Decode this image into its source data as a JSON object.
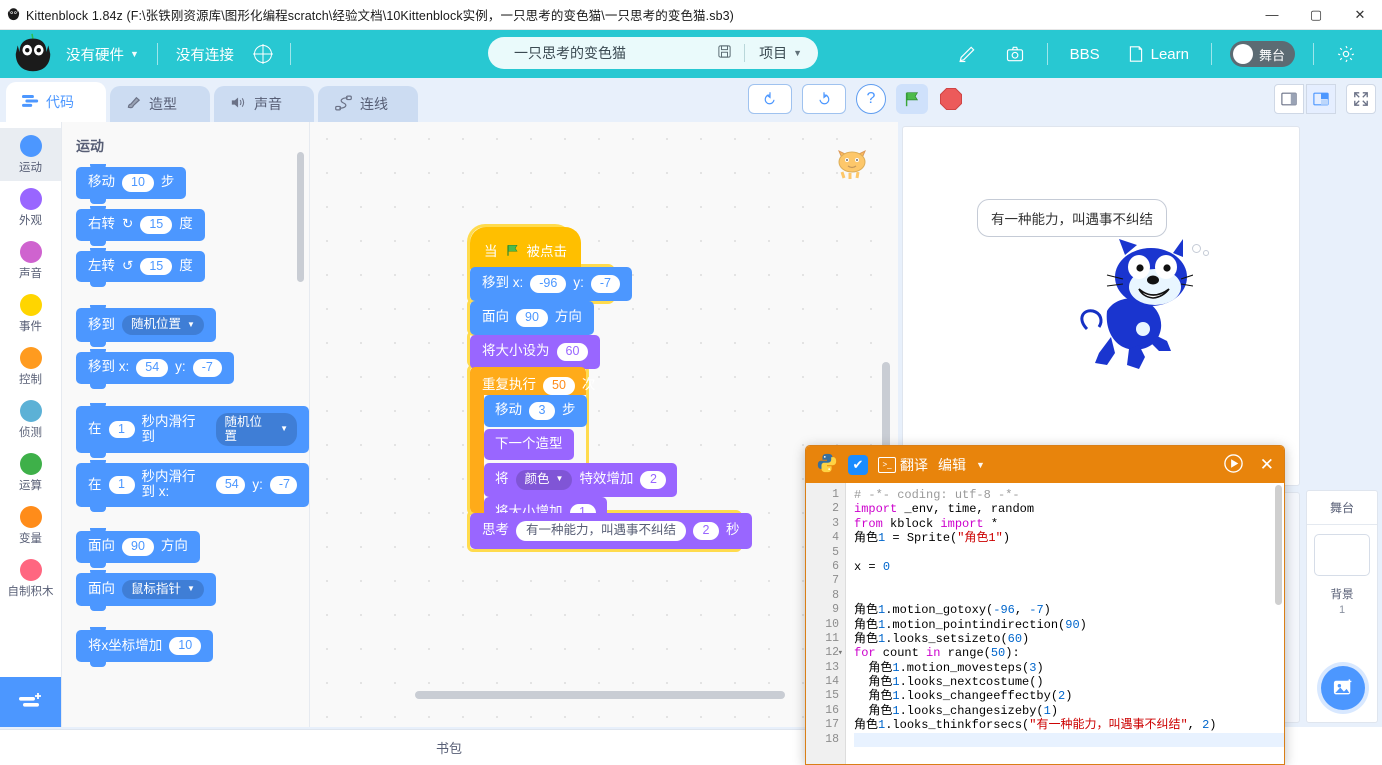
{
  "window": {
    "title": "Kittenblock 1.84z (F:\\张铁刚资源库\\图形化编程scratch\\经验文档\\10Kittenblock实例，一只思考的变色猫\\一只思考的变色猫.sb3)",
    "app_icon": "cat-logo-icon",
    "minimize": "—",
    "maximize": "▢",
    "close": "✕"
  },
  "menubar": {
    "hardware": "没有硬件",
    "connection": "没有连接",
    "globe_icon": "globe-icon",
    "project_name": "一只思考的变色猫",
    "save_icon": "save-icon",
    "project_menu": "项目",
    "edit_icon": "pencil-icon",
    "camera_icon": "camera-icon",
    "bbs": "BBS",
    "learn": "Learn",
    "stage_toggle": "舞台",
    "settings_icon": "gear-icon"
  },
  "tabs": [
    {
      "label": "代码",
      "icon": "code-icon",
      "active": true
    },
    {
      "label": "造型",
      "icon": "brush-icon",
      "active": false
    },
    {
      "label": "声音",
      "icon": "speaker-icon",
      "active": false
    },
    {
      "label": "连线",
      "icon": "wire-icon",
      "active": false
    }
  ],
  "toolbar": {
    "undo_icon": "undo-icon",
    "redo_icon": "redo-icon",
    "help_icon": "help-icon",
    "green_flag_icon": "green-flag-icon",
    "stop_icon": "stop-sign-icon",
    "layout_small_icon": "layout-small-icon",
    "layout_normal_icon": "layout-normal-icon",
    "layout_full_icon": "fullscreen-icon"
  },
  "categories": [
    {
      "label": "运动",
      "color": "#4c97ff",
      "active": true
    },
    {
      "label": "外观",
      "color": "#9966ff",
      "active": false
    },
    {
      "label": "声音",
      "color": "#cf63cf",
      "active": false
    },
    {
      "label": "事件",
      "color": "#ffd500",
      "active": false
    },
    {
      "label": "控制",
      "color": "#ff9b1f",
      "active": false
    },
    {
      "label": "侦测",
      "color": "#5cb1d6",
      "active": false
    },
    {
      "label": "运算",
      "color": "#3eb049",
      "active": false
    },
    {
      "label": "变量",
      "color": "#ff8c1a",
      "active": false
    },
    {
      "label": "自制积木",
      "color": "#ff6680",
      "active": false
    }
  ],
  "add_extension_icon": "add-extension-icon",
  "palette": {
    "title": "运动",
    "blocks": [
      {
        "id": "movesteps",
        "parts": [
          {
            "t": "text",
            "v": "移动"
          },
          {
            "t": "oval",
            "v": "10"
          },
          {
            "t": "text",
            "v": "步"
          }
        ]
      },
      {
        "id": "turnright",
        "parts": [
          {
            "t": "text",
            "v": "右转"
          },
          {
            "t": "text",
            "v": "↻"
          },
          {
            "t": "oval",
            "v": "15"
          },
          {
            "t": "text",
            "v": "度"
          }
        ]
      },
      {
        "id": "turnleft",
        "parts": [
          {
            "t": "text",
            "v": "左转"
          },
          {
            "t": "text",
            "v": "↺"
          },
          {
            "t": "oval",
            "v": "15"
          },
          {
            "t": "text",
            "v": "度"
          }
        ]
      },
      {
        "id": "gotorandom",
        "parts": [
          {
            "t": "text",
            "v": "移到"
          },
          {
            "t": "drop",
            "v": "随机位置"
          }
        ]
      },
      {
        "id": "gotoxy",
        "parts": [
          {
            "t": "text",
            "v": "移到 x:"
          },
          {
            "t": "oval",
            "v": "54"
          },
          {
            "t": "text",
            "v": "y:"
          },
          {
            "t": "oval",
            "v": "-7"
          }
        ]
      },
      {
        "id": "glidetorandom",
        "parts": [
          {
            "t": "text",
            "v": "在"
          },
          {
            "t": "oval",
            "v": "1"
          },
          {
            "t": "text",
            "v": "秒内滑行到"
          },
          {
            "t": "drop",
            "v": "随机位置"
          }
        ]
      },
      {
        "id": "glidetoxy",
        "parts": [
          {
            "t": "text",
            "v": "在"
          },
          {
            "t": "oval",
            "v": "1"
          },
          {
            "t": "text",
            "v": "秒内滑行到 x:"
          },
          {
            "t": "oval",
            "v": "54"
          },
          {
            "t": "text",
            "v": "y:"
          },
          {
            "t": "oval",
            "v": "-7"
          }
        ]
      },
      {
        "id": "pointindirection",
        "parts": [
          {
            "t": "text",
            "v": "面向"
          },
          {
            "t": "oval",
            "v": "90"
          },
          {
            "t": "text",
            "v": "方向"
          }
        ]
      },
      {
        "id": "pointtowards",
        "parts": [
          {
            "t": "text",
            "v": "面向"
          },
          {
            "t": "drop",
            "v": "鼠标指针"
          }
        ]
      },
      {
        "id": "changexby",
        "parts": [
          {
            "t": "text",
            "v": "将x坐标增加"
          },
          {
            "t": "oval",
            "v": "10"
          }
        ]
      }
    ]
  },
  "script": {
    "hat": {
      "prefix": "当",
      "flag_icon": "green-flag-icon",
      "suffix": "被点击"
    },
    "blocks": [
      {
        "id": "gotoxy",
        "cat": "motion",
        "parts": [
          {
            "t": "text",
            "v": "移到 x:"
          },
          {
            "t": "oval",
            "v": "-96"
          },
          {
            "t": "text",
            "v": "y:"
          },
          {
            "t": "oval",
            "v": "-7"
          }
        ]
      },
      {
        "id": "pointdir",
        "cat": "motion",
        "parts": [
          {
            "t": "text",
            "v": "面向"
          },
          {
            "t": "oval",
            "v": "90"
          },
          {
            "t": "text",
            "v": "方向"
          }
        ]
      },
      {
        "id": "setsizeto",
        "cat": "looks",
        "parts": [
          {
            "t": "text",
            "v": "将大小设为"
          },
          {
            "t": "oval",
            "v": "60"
          }
        ]
      },
      {
        "id": "repeat",
        "cat": "control",
        "parts": [
          {
            "t": "text",
            "v": "重复执行"
          },
          {
            "t": "oval",
            "v": "50"
          },
          {
            "t": "text",
            "v": "次"
          }
        ]
      },
      {
        "id": "movesteps",
        "cat": "motion",
        "nested": true,
        "parts": [
          {
            "t": "text",
            "v": "移动"
          },
          {
            "t": "oval",
            "v": "3"
          },
          {
            "t": "text",
            "v": "步"
          }
        ]
      },
      {
        "id": "nextcostume",
        "cat": "looks",
        "nested": true,
        "parts": [
          {
            "t": "text",
            "v": "下一个造型"
          }
        ]
      },
      {
        "id": "changeeffect",
        "cat": "looks",
        "nested": true,
        "parts": [
          {
            "t": "text",
            "v": "将"
          },
          {
            "t": "drop",
            "v": "颜色"
          },
          {
            "t": "text",
            "v": "特效增加"
          },
          {
            "t": "oval",
            "v": "2"
          }
        ]
      },
      {
        "id": "changesize",
        "cat": "looks",
        "nested": true,
        "parts": [
          {
            "t": "text",
            "v": "将大小增加"
          },
          {
            "t": "oval",
            "v": "1"
          }
        ]
      },
      {
        "id": "thinkforsecs",
        "cat": "looks",
        "parts": [
          {
            "t": "text",
            "v": "思考"
          },
          {
            "t": "textin",
            "v": "有一种能力，叫遇事不纠结"
          },
          {
            "t": "oval",
            "v": "2"
          },
          {
            "t": "text",
            "v": "秒"
          }
        ]
      }
    ]
  },
  "stage": {
    "bubble_text": "有一种能力，叫遇事不纠结",
    "sprite_name": "角色1",
    "side": {
      "title": "舞台",
      "sub": "背景",
      "count": "1"
    },
    "add_backdrop_icon": "add-image-icon"
  },
  "backpack": {
    "label": "书包"
  },
  "python_editor": {
    "title_icon": "python-icon",
    "check_icon": "check-icon",
    "terminal_icon": "terminal-icon",
    "translate": "翻译",
    "edit": "编辑",
    "run_icon": "run-icon",
    "close_icon": "close-icon",
    "lines": [
      {
        "n": "1",
        "fold": "",
        "tokens": [
          {
            "c": "cm",
            "v": "# -*- coding: utf-8 -*-"
          }
        ]
      },
      {
        "n": "2",
        "fold": "",
        "tokens": [
          {
            "c": "kw",
            "v": "import"
          },
          {
            "c": "id",
            "v": " _env, time, random"
          }
        ]
      },
      {
        "n": "3",
        "fold": "",
        "tokens": [
          {
            "c": "kw",
            "v": "from"
          },
          {
            "c": "id",
            "v": " kblock "
          },
          {
            "c": "kw",
            "v": "import"
          },
          {
            "c": "id",
            "v": " *"
          }
        ]
      },
      {
        "n": "4",
        "fold": "",
        "tokens": [
          {
            "c": "id",
            "v": "角色"
          },
          {
            "c": "num",
            "v": "1"
          },
          {
            "c": "id",
            "v": " = Sprite("
          },
          {
            "c": "str",
            "v": "\"角色1\""
          },
          {
            "c": "id",
            "v": ")"
          }
        ]
      },
      {
        "n": "5",
        "fold": "",
        "tokens": []
      },
      {
        "n": "6",
        "fold": "",
        "tokens": [
          {
            "c": "id",
            "v": "x = "
          },
          {
            "c": "num",
            "v": "0"
          }
        ]
      },
      {
        "n": "7",
        "fold": "",
        "tokens": []
      },
      {
        "n": "8",
        "fold": "",
        "tokens": []
      },
      {
        "n": "9",
        "fold": "",
        "tokens": [
          {
            "c": "id",
            "v": "角色"
          },
          {
            "c": "num",
            "v": "1"
          },
          {
            "c": "id",
            "v": ".motion_gotoxy("
          },
          {
            "c": "num",
            "v": "-96"
          },
          {
            "c": "id",
            "v": ", "
          },
          {
            "c": "num",
            "v": "-7"
          },
          {
            "c": "id",
            "v": ")"
          }
        ]
      },
      {
        "n": "10",
        "fold": "",
        "tokens": [
          {
            "c": "id",
            "v": "角色"
          },
          {
            "c": "num",
            "v": "1"
          },
          {
            "c": "id",
            "v": ".motion_pointindirection("
          },
          {
            "c": "num",
            "v": "90"
          },
          {
            "c": "id",
            "v": ")"
          }
        ]
      },
      {
        "n": "11",
        "fold": "",
        "tokens": [
          {
            "c": "id",
            "v": "角色"
          },
          {
            "c": "num",
            "v": "1"
          },
          {
            "c": "id",
            "v": ".looks_setsizeto("
          },
          {
            "c": "num",
            "v": "60"
          },
          {
            "c": "id",
            "v": ")"
          }
        ]
      },
      {
        "n": "12",
        "fold": "▾",
        "tokens": [
          {
            "c": "kw",
            "v": "for"
          },
          {
            "c": "id",
            "v": " count "
          },
          {
            "c": "kw",
            "v": "in"
          },
          {
            "c": "id",
            "v": " range("
          },
          {
            "c": "num",
            "v": "50"
          },
          {
            "c": "id",
            "v": "):"
          }
        ]
      },
      {
        "n": "13",
        "fold": "",
        "tokens": [
          {
            "c": "id",
            "v": "  角色"
          },
          {
            "c": "num",
            "v": "1"
          },
          {
            "c": "id",
            "v": ".motion_movesteps("
          },
          {
            "c": "num",
            "v": "3"
          },
          {
            "c": "id",
            "v": ")"
          }
        ]
      },
      {
        "n": "14",
        "fold": "",
        "tokens": [
          {
            "c": "id",
            "v": "  角色"
          },
          {
            "c": "num",
            "v": "1"
          },
          {
            "c": "id",
            "v": ".looks_nextcostume()"
          }
        ]
      },
      {
        "n": "15",
        "fold": "",
        "tokens": [
          {
            "c": "id",
            "v": "  角色"
          },
          {
            "c": "num",
            "v": "1"
          },
          {
            "c": "id",
            "v": ".looks_changeeffectby("
          },
          {
            "c": "num",
            "v": "2"
          },
          {
            "c": "id",
            "v": ")"
          }
        ]
      },
      {
        "n": "16",
        "fold": "",
        "tokens": [
          {
            "c": "id",
            "v": "  角色"
          },
          {
            "c": "num",
            "v": "1"
          },
          {
            "c": "id",
            "v": ".looks_changesizeby("
          },
          {
            "c": "num",
            "v": "1"
          },
          {
            "c": "id",
            "v": ")"
          }
        ]
      },
      {
        "n": "17",
        "fold": "",
        "tokens": [
          {
            "c": "id",
            "v": "角色"
          },
          {
            "c": "num",
            "v": "1"
          },
          {
            "c": "id",
            "v": ".looks_thinkforsecs("
          },
          {
            "c": "str",
            "v": "\"有一种能力，叫遇事不纠结\""
          },
          {
            "c": "id",
            "v": ", "
          },
          {
            "c": "num",
            "v": "2"
          },
          {
            "c": "id",
            "v": ")"
          }
        ]
      },
      {
        "n": "18",
        "fold": "",
        "tokens": [],
        "cursor": true
      }
    ]
  },
  "colors": {
    "brand": "#28c8d2",
    "motion": "#4c97ff",
    "looks": "#9966ff",
    "events": "#ffbf00",
    "control": "#ffab19",
    "python_header": "#e8840c",
    "glow": "#ffdb4d"
  }
}
